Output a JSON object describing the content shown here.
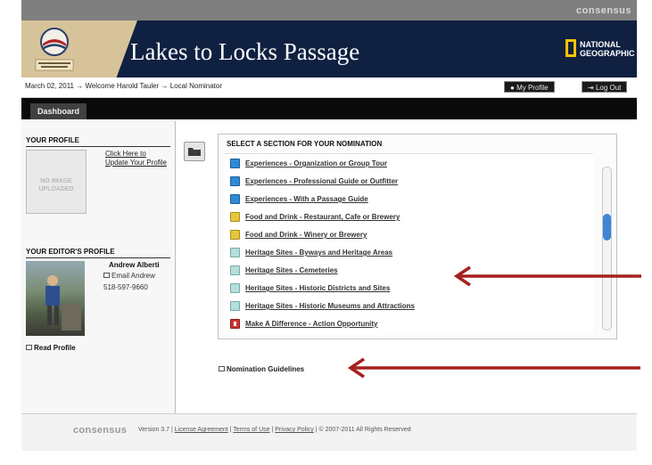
{
  "top_brand": "consensus",
  "header": {
    "site_title": "Lakes to Locks Passage",
    "partner_logo_text": "NATIONAL GEOGRAPHIC"
  },
  "breadcrumb": {
    "text": "March 02, 2011 → Welcome Harold Tauler → Local Nominator",
    "my_profile": "My Profile",
    "log_out": "Log Out"
  },
  "tabs": [
    "Dashboard"
  ],
  "sidebar": {
    "profile_title": "YOUR PROFILE",
    "no_image_line1": "NO IMAGE",
    "no_image_line2": "UPLOADED",
    "update_link": "Click Here to Update Your Profile",
    "editor_title": "YOUR EDITOR'S PROFILE",
    "editor_name": "Andrew Alberti",
    "editor_email": "Email Andrew",
    "editor_phone": "518-597-9660",
    "read_profile": "Read Profile"
  },
  "nomination": {
    "title": "SELECT A SECTION FOR YOUR NOMINATION",
    "items": [
      {
        "label": "Experiences - Organization or Group Tour",
        "icon": "blue-square-icon"
      },
      {
        "label": "Experiences - Professional Guide or Outfitter",
        "icon": "blue-square-icon"
      },
      {
        "label": "Experiences - With a Passage Guide",
        "icon": "blue-square-icon"
      },
      {
        "label": "Food and Drink - Restaurant, Cafe or Brewery",
        "icon": "yellow-square-icon"
      },
      {
        "label": "Food and Drink - Winery or Brewery",
        "icon": "yellow-square-icon"
      },
      {
        "label": "Heritage Sites - Byways and Heritage Areas",
        "icon": "teal-square-icon"
      },
      {
        "label": "Heritage Sites - Cemeteries",
        "icon": "teal-square-icon"
      },
      {
        "label": "Heritage Sites - Historic Districts and Sites",
        "icon": "teal-square-icon"
      },
      {
        "label": "Heritage Sites - Historic Museums and Attractions",
        "icon": "teal-square-icon"
      },
      {
        "label": "Make A Difference - Action Opportunity",
        "icon": "red-square-icon"
      }
    ],
    "guidelines": "Nomination Guidelines"
  },
  "footer": {
    "brand": "consensus",
    "version": "Version 3.7",
    "license": "License Agreement",
    "terms": "Terms of Use",
    "privacy": "Privacy Policy",
    "copyright": "© 2007-2011 All Rights Reserved"
  },
  "colors": {
    "header_bg": "#0f2041",
    "header_tan": "#d7c39a",
    "tab_bar": "#0a0a0a",
    "annotation_arrow": "#a6201e"
  }
}
